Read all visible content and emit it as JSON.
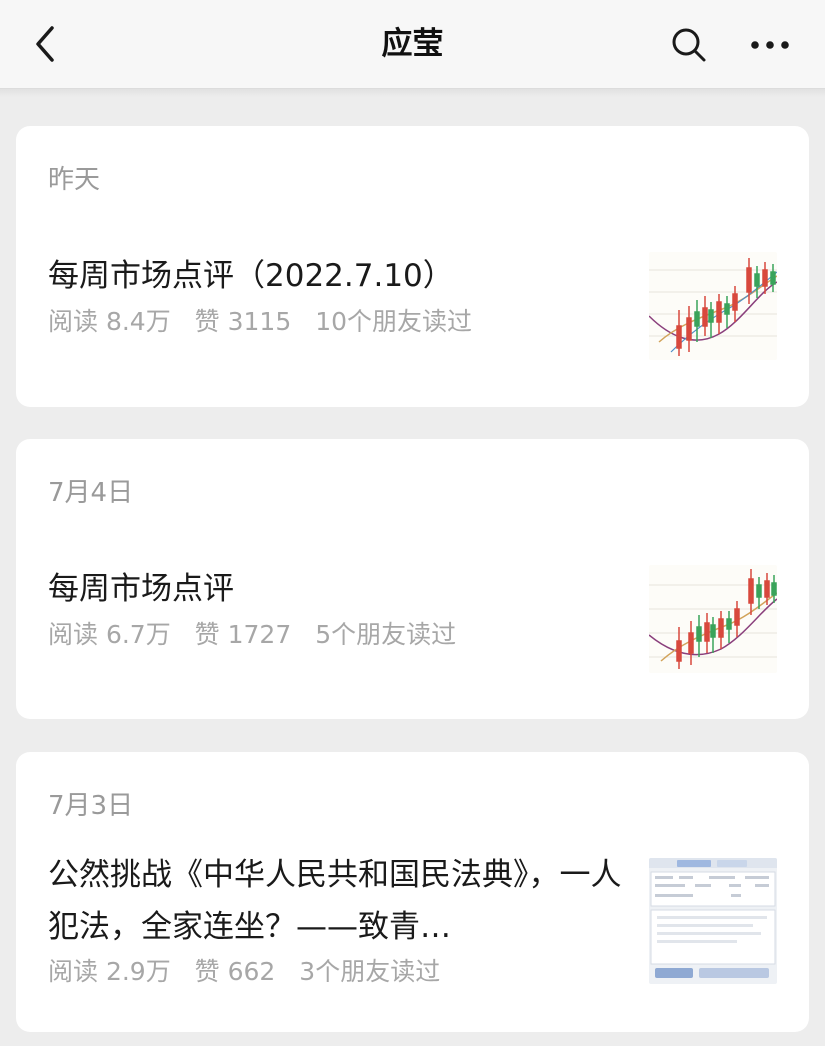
{
  "header": {
    "title": "应莹",
    "back_icon": "chevron-left-icon",
    "search_icon": "search-icon",
    "more_icon": "more-dots-icon"
  },
  "articles": [
    {
      "date": "昨天",
      "title": "每周市场点评（2022.7.10）",
      "reads": "阅读 8.4万",
      "likes": "赞 3115",
      "friends": "10个朋友读过",
      "thumbnail": "stock-chart-thumbnail"
    },
    {
      "date": "7月4日",
      "title": "每周市场点评",
      "reads": "阅读 6.7万",
      "likes": "赞 1727",
      "friends": "5个朋友读过",
      "thumbnail": "stock-chart-thumbnail"
    },
    {
      "date": "7月3日",
      "title": "公然挑战《中华人民共和国民法典》，一人犯法，全家连坐？——致青…",
      "reads": "阅读 2.9万",
      "likes": "赞 662",
      "friends": "3个朋友读过",
      "thumbnail": "screenshot-thumbnail"
    }
  ],
  "colors": {
    "background": "#ededed",
    "card": "#ffffff",
    "title_text": "#1a1a1a",
    "meta_text": "#a7a7a7"
  }
}
